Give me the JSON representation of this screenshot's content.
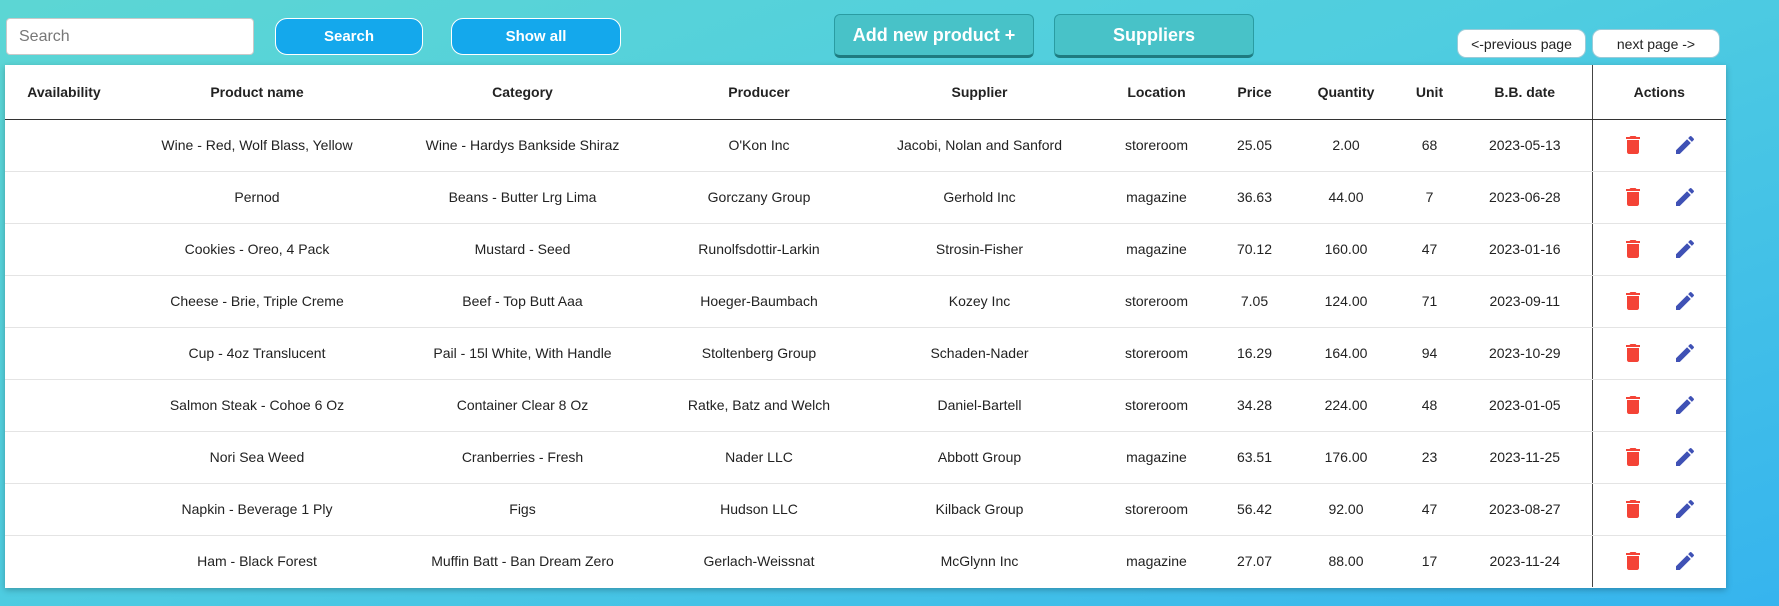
{
  "toolbar": {
    "search_placeholder": "Search",
    "search_button": "Search",
    "show_all_button": "Show all",
    "add_product_button": "Add new product +",
    "suppliers_button": "Suppliers",
    "prev_page_button": "<-previous page",
    "next_page_button": "next page ->"
  },
  "table": {
    "columns": [
      "Availability",
      "Product name",
      "Category",
      "Producer",
      "Supplier",
      "Location",
      "Price",
      "Quantity",
      "Unit",
      "B.B. date",
      "Actions"
    ],
    "rows": [
      {
        "availability": "",
        "product": "Wine - Red, Wolf Blass, Yellow",
        "category": "Wine - Hardys Bankside Shiraz",
        "producer": "O'Kon Inc",
        "supplier": "Jacobi, Nolan and Sanford",
        "location": "storeroom",
        "price": "25.05",
        "quantity": "2.00",
        "unit": "68",
        "bb_date": "2023-05-13"
      },
      {
        "availability": "",
        "product": "Pernod",
        "category": "Beans - Butter Lrg Lima",
        "producer": "Gorczany Group",
        "supplier": "Gerhold Inc",
        "location": "magazine",
        "price": "36.63",
        "quantity": "44.00",
        "unit": "7",
        "bb_date": "2023-06-28"
      },
      {
        "availability": "",
        "product": "Cookies - Oreo, 4 Pack",
        "category": "Mustard - Seed",
        "producer": "Runolfsdottir-Larkin",
        "supplier": "Strosin-Fisher",
        "location": "magazine",
        "price": "70.12",
        "quantity": "160.00",
        "unit": "47",
        "bb_date": "2023-01-16"
      },
      {
        "availability": "",
        "product": "Cheese - Brie, Triple Creme",
        "category": "Beef - Top Butt Aaa",
        "producer": "Hoeger-Baumbach",
        "supplier": "Kozey Inc",
        "location": "storeroom",
        "price": "7.05",
        "quantity": "124.00",
        "unit": "71",
        "bb_date": "2023-09-11"
      },
      {
        "availability": "",
        "product": "Cup - 4oz Translucent",
        "category": "Pail - 15l White, With Handle",
        "producer": "Stoltenberg Group",
        "supplier": "Schaden-Nader",
        "location": "storeroom",
        "price": "16.29",
        "quantity": "164.00",
        "unit": "94",
        "bb_date": "2023-10-29"
      },
      {
        "availability": "",
        "product": "Salmon Steak - Cohoe 6 Oz",
        "category": "Container Clear 8 Oz",
        "producer": "Ratke, Batz and Welch",
        "supplier": "Daniel-Bartell",
        "location": "storeroom",
        "price": "34.28",
        "quantity": "224.00",
        "unit": "48",
        "bb_date": "2023-01-05"
      },
      {
        "availability": "",
        "product": "Nori Sea Weed",
        "category": "Cranberries - Fresh",
        "producer": "Nader LLC",
        "supplier": "Abbott Group",
        "location": "magazine",
        "price": "63.51",
        "quantity": "176.00",
        "unit": "23",
        "bb_date": "2023-11-25"
      },
      {
        "availability": "",
        "product": "Napkin - Beverage 1 Ply",
        "category": "Figs",
        "producer": "Hudson LLC",
        "supplier": "Kilback Group",
        "location": "storeroom",
        "price": "56.42",
        "quantity": "92.00",
        "unit": "47",
        "bb_date": "2023-08-27"
      },
      {
        "availability": "",
        "product": "Ham - Black Forest",
        "category": "Muffin Batt - Ban Dream Zero",
        "producer": "Gerlach-Weissnat",
        "supplier": "McGlynn Inc",
        "location": "magazine",
        "price": "27.07",
        "quantity": "88.00",
        "unit": "17",
        "bb_date": "2023-11-24"
      }
    ],
    "row_actions": {
      "delete_icon": "trash-icon",
      "edit_icon": "pencil-icon"
    }
  },
  "colors": {
    "background_start": "#5cd6d4",
    "background_end": "#36b4ee",
    "primary_button": "#14a8ec",
    "teal_button": "#48c2c8",
    "delete_icon": "#f44336",
    "edit_icon": "#3f51b5"
  }
}
